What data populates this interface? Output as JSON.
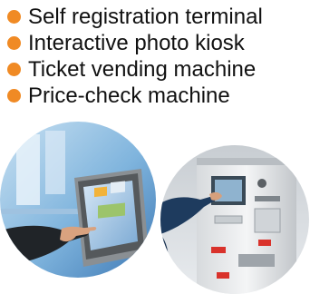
{
  "colors": {
    "bullet": "#f08a24",
    "text": "#111111"
  },
  "features": [
    {
      "label": "Self registration terminal"
    },
    {
      "label": "Interactive photo kiosk"
    },
    {
      "label": "Ticket vending machine"
    },
    {
      "label": "Price-check machine"
    }
  ]
}
